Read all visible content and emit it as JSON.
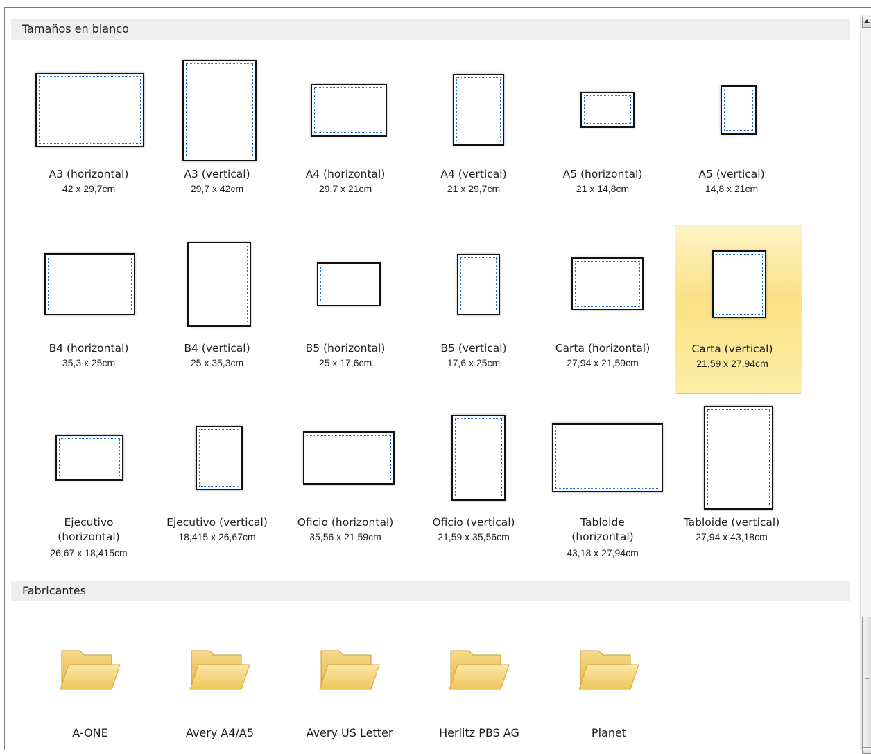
{
  "sections": {
    "blank_sizes": {
      "title": "Tamaños en blanco"
    },
    "manufacturers": {
      "title": "Fabricantes"
    }
  },
  "paper_sizes": [
    {
      "name": "A3 (horizontal)",
      "dims": "42 x 29,7cm"
    },
    {
      "name": "A3 (vertical)",
      "dims": "29,7 x 42cm"
    },
    {
      "name": "A4 (horizontal)",
      "dims": "29,7 x 21cm"
    },
    {
      "name": "A4 (vertical)",
      "dims": "21 x 29,7cm"
    },
    {
      "name": "A5 (horizontal)",
      "dims": "21 x 14,8cm"
    },
    {
      "name": "A5 (vertical)",
      "dims": "14,8 x 21cm"
    },
    {
      "name": "B4 (horizontal)",
      "dims": "35,3 x 25cm"
    },
    {
      "name": "B4 (vertical)",
      "dims": "25 x 35,3cm"
    },
    {
      "name": "B5 (horizontal)",
      "dims": "25 x 17,6cm"
    },
    {
      "name": "B5 (vertical)",
      "dims": "17,6 x 25cm"
    },
    {
      "name": "Carta (horizontal)",
      "dims": "27,94 x 21,59cm"
    },
    {
      "name": "Carta (vertical)",
      "dims": "21,59 x 27,94cm",
      "selected": true
    },
    {
      "name": "Ejecutivo (horizontal)",
      "dims": "26,67 x 18,415cm"
    },
    {
      "name": "Ejecutivo (vertical)",
      "dims": "18,415 x 26,67cm"
    },
    {
      "name": "Oficio (horizontal)",
      "dims": "35,56 x 21,59cm"
    },
    {
      "name": "Oficio (vertical)",
      "dims": "21,59 x 35,56cm"
    },
    {
      "name": "Tabloide (horizontal)",
      "dims": "43,18 x 27,94cm"
    },
    {
      "name": "Tabloide (vertical)",
      "dims": "27,94 x 43,18cm"
    }
  ],
  "manufacturers": [
    {
      "name": "A-ONE",
      "icon": "folder-icon"
    },
    {
      "name": "Avery A4/A5",
      "icon": "folder-icon"
    },
    {
      "name": "Avery US Letter",
      "icon": "folder-icon"
    },
    {
      "name": "Herlitz PBS AG",
      "icon": "folder-icon"
    },
    {
      "name": "Planet",
      "icon": "folder-icon"
    }
  ],
  "colors": {
    "selection": "#fbe184",
    "page_border_dotted": "#1a6fd8",
    "folder": "#f4c862"
  }
}
